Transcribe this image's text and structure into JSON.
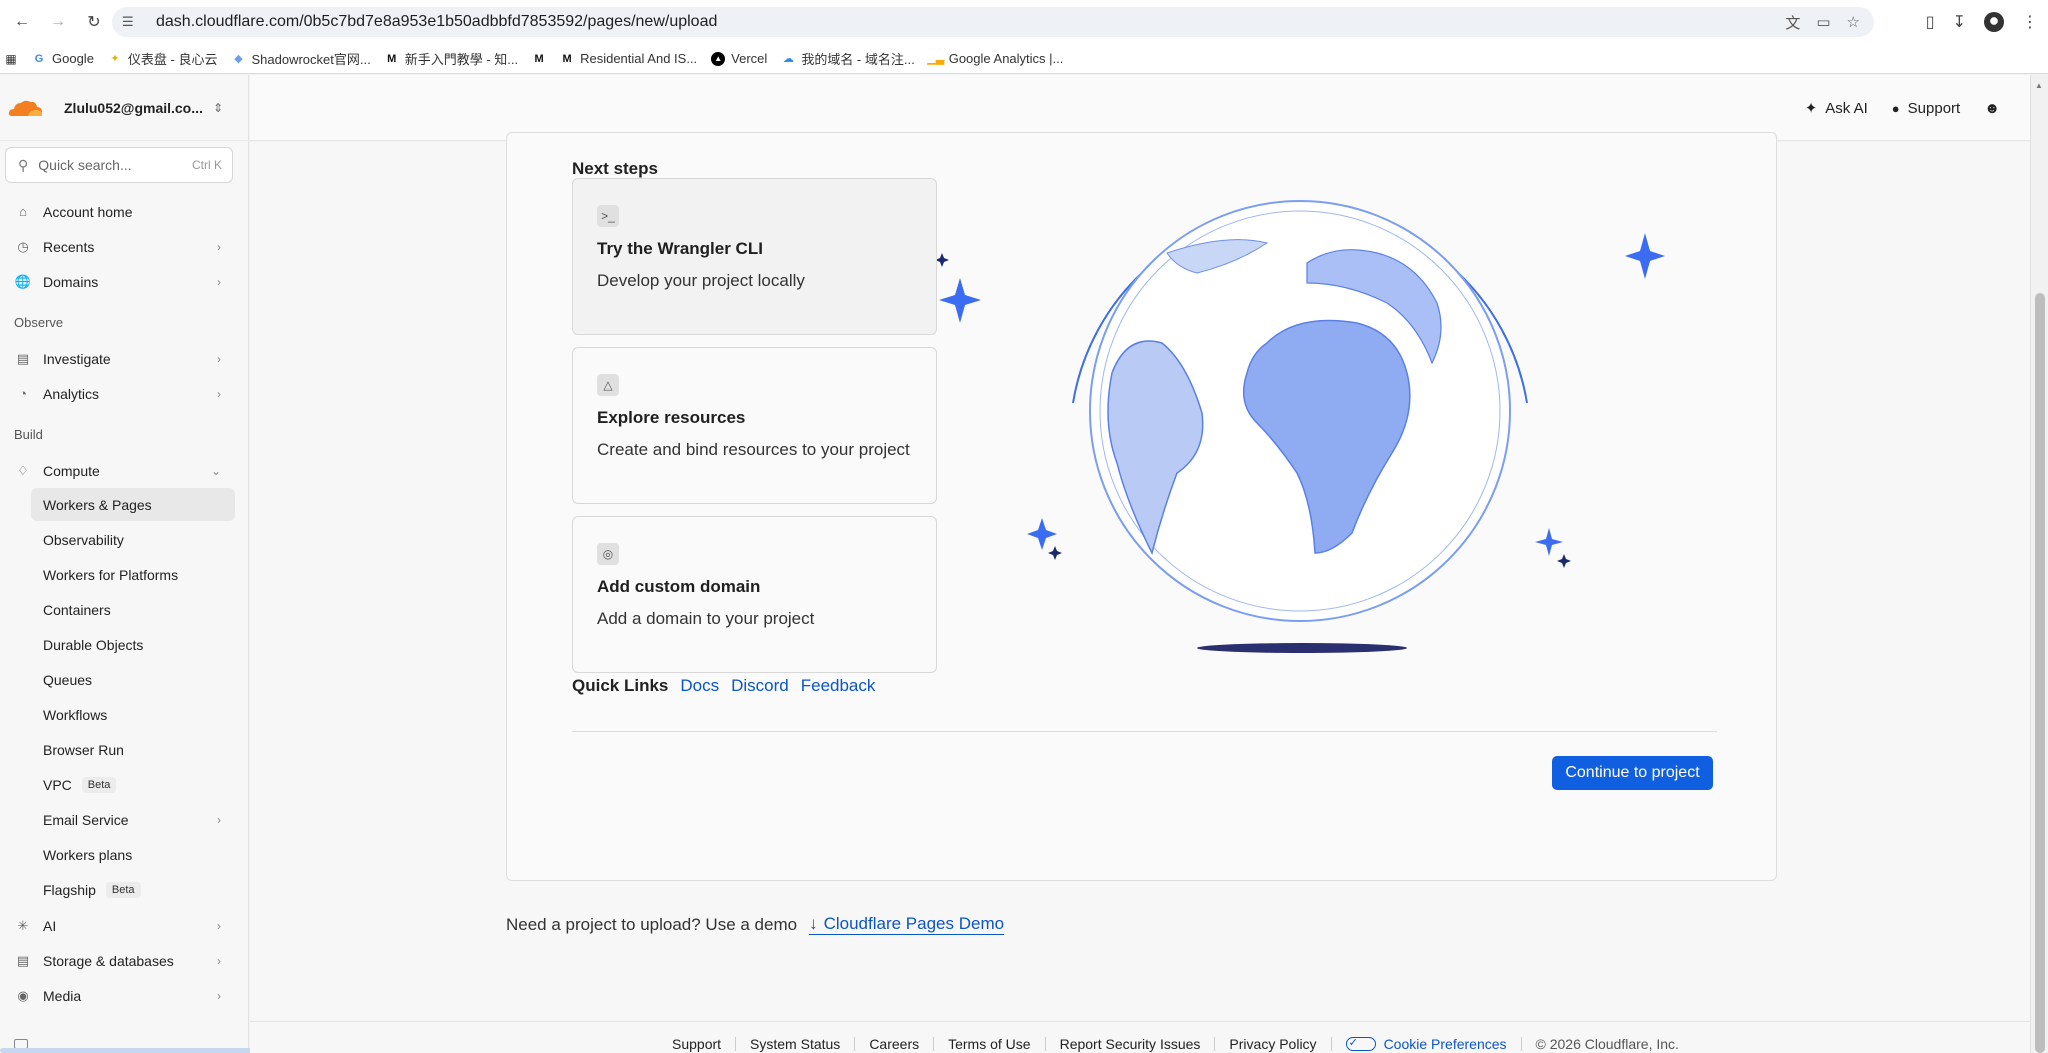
{
  "browser": {
    "url": "dash.cloudflare.com/0b5c7bd7e8a953e1b50adbbfd7853592/pages/new/upload",
    "bookmarks": [
      {
        "label": "Google",
        "icon": "google-icon"
      },
      {
        "label": "仪表盘 - 良心云",
        "icon": "star-icon"
      },
      {
        "label": "Shadowrocket官网...",
        "icon": "rocket-icon"
      },
      {
        "label": "新手入門教學 - 知...",
        "icon": "m-logo-icon"
      },
      {
        "label": "",
        "icon": "m-logo-icon"
      },
      {
        "label": "Residential And IS...",
        "icon": "m-logo-icon"
      },
      {
        "label": "Vercel",
        "icon": "vercel-icon"
      },
      {
        "label": "我的域名 - 域名注...",
        "icon": "cloud-icon"
      },
      {
        "label": "Google Analytics |...",
        "icon": "analytics-icon"
      }
    ]
  },
  "sidebar": {
    "account": "Zlulu052@gmail.co...",
    "search_placeholder": "Quick search...",
    "search_shortcut": "Ctrl K",
    "items": {
      "account_home": "Account home",
      "recents": "Recents",
      "domains": "Domains",
      "observe": "Observe",
      "investigate": "Investigate",
      "analytics": "Analytics",
      "build": "Build",
      "compute": "Compute",
      "ai": "AI",
      "storage": "Storage & databases",
      "media": "Media"
    },
    "compute_children": [
      {
        "label": "Workers & Pages",
        "badge": ""
      },
      {
        "label": "Observability",
        "badge": ""
      },
      {
        "label": "Workers for Platforms",
        "badge": ""
      },
      {
        "label": "Containers",
        "badge": ""
      },
      {
        "label": "Durable Objects",
        "badge": ""
      },
      {
        "label": "Queues",
        "badge": ""
      },
      {
        "label": "Workflows",
        "badge": ""
      },
      {
        "label": "Browser Run",
        "badge": ""
      },
      {
        "label": "VPC",
        "badge": "Beta"
      },
      {
        "label": "Email Service",
        "badge": ""
      },
      {
        "label": "Workers plans",
        "badge": ""
      },
      {
        "label": "Flagship",
        "badge": "Beta"
      }
    ]
  },
  "header": {
    "ask_ai": "Ask AI",
    "support": "Support"
  },
  "main": {
    "next_steps_title": "Next steps",
    "steps": [
      {
        "title": "Try the Wrangler CLI",
        "desc": "Develop your project locally",
        "icon": "terminal-icon"
      },
      {
        "title": "Explore resources",
        "desc": "Create and bind resources to your project",
        "icon": "hierarchy-icon"
      },
      {
        "title": "Add custom domain",
        "desc": "Add a domain to your project",
        "icon": "globe-icon"
      }
    ],
    "quick_links_label": "Quick Links",
    "quick_links": [
      "Docs",
      "Discord",
      "Feedback"
    ],
    "continue_label": "Continue to project",
    "demo_text": "Need a project to upload? Use a demo",
    "demo_link": "Cloudflare Pages Demo"
  },
  "footer": {
    "links": [
      "Support",
      "System Status",
      "Careers",
      "Terms of Use",
      "Report Security Issues",
      "Privacy Policy"
    ],
    "cookie": "Cookie Preferences",
    "copyright": "© 2026 Cloudflare, Inc."
  },
  "colors": {
    "accent": "#0f5fe0",
    "link": "#0b55c7",
    "globe": "#7b9ef0",
    "cloudflare_orange": "#f38020"
  }
}
